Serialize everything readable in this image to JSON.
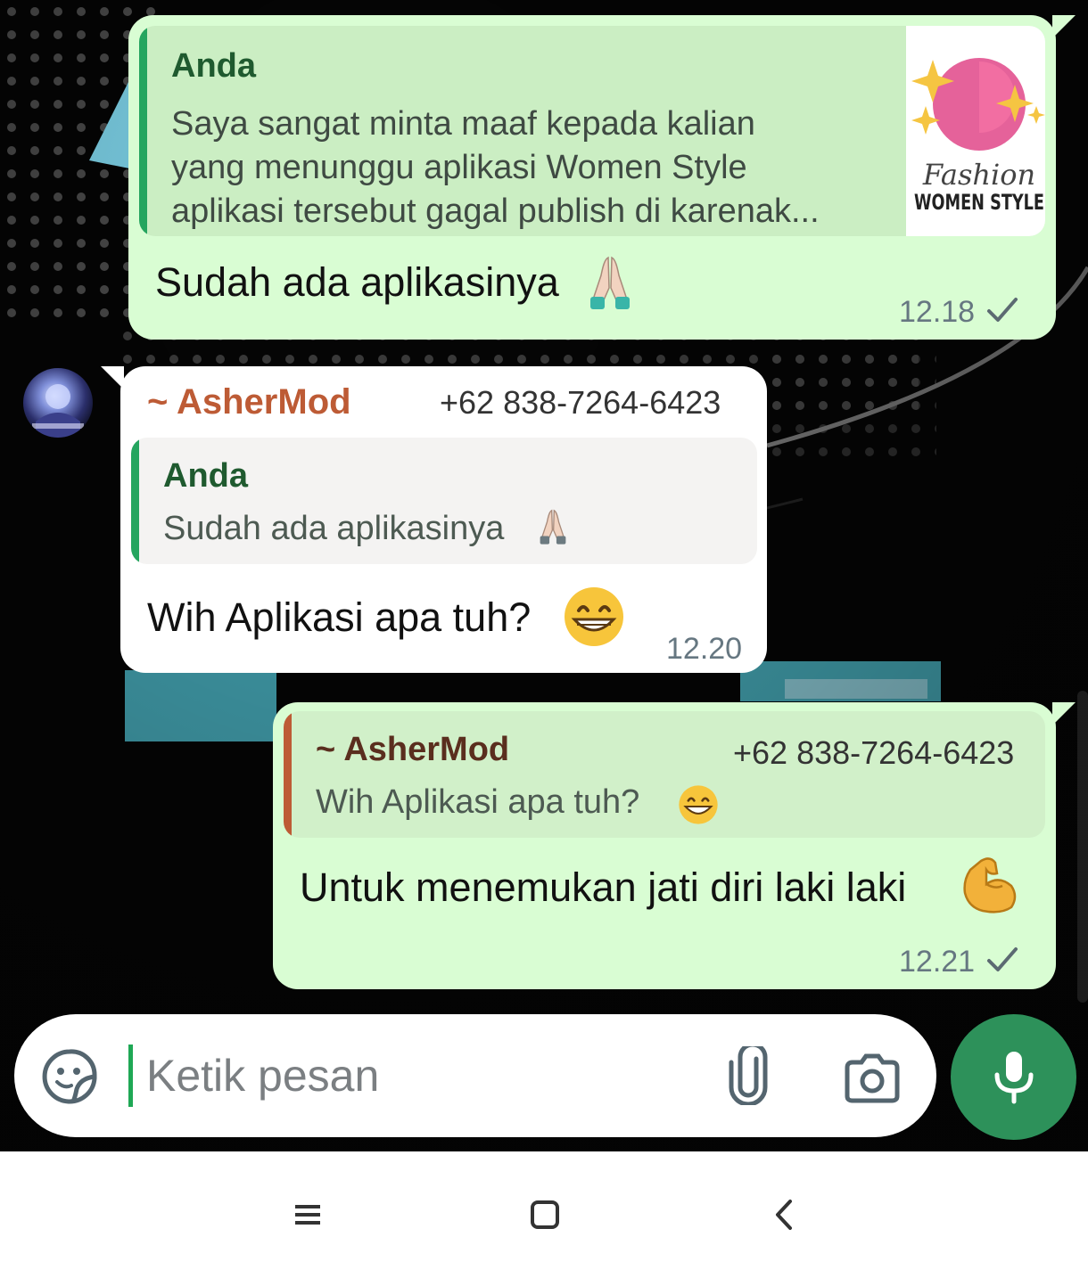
{
  "messages": [
    {
      "direction": "outgoing",
      "quote": {
        "author": "Anda",
        "lines": [
          "Saya sangat minta maaf kepada kalian",
          "yang menunggu aplikasi Women Style",
          "aplikasi tersebut gagal publish di karenak..."
        ],
        "thumbnail": {
          "script_text": "Fashion",
          "brand_text": "WOMEN STYLE"
        }
      },
      "text": "Sudah ada aplikasinya",
      "emoji": "folded-hands",
      "time": "12.18",
      "status": "sent"
    },
    {
      "direction": "incoming",
      "sender": "~ AsherMod",
      "phone": "+62 838-7264-6423",
      "quote": {
        "author": "Anda",
        "text": "Sudah ada aplikasinya"
      },
      "text": "Wih Aplikasi apa tuh?",
      "emoji": "grinning-face",
      "time": "12.20"
    },
    {
      "direction": "outgoing",
      "quote": {
        "author": "~ AsherMod",
        "phone": "+62 838-7264-6423",
        "text": "Wih Aplikasi apa tuh?"
      },
      "text": "Untuk menemukan jati diri laki laki",
      "emoji": "flexed-biceps",
      "time": "12.21",
      "status": "sent"
    }
  ],
  "composer": {
    "placeholder": "Ketik pesan"
  },
  "colors": {
    "outgoing_bubble": "#d9fdd3",
    "incoming_bubble": "#ffffff",
    "quote_bar_self": "#25a55f",
    "quote_bar_other": "#bd5b35",
    "mic_button": "#2d915a"
  }
}
